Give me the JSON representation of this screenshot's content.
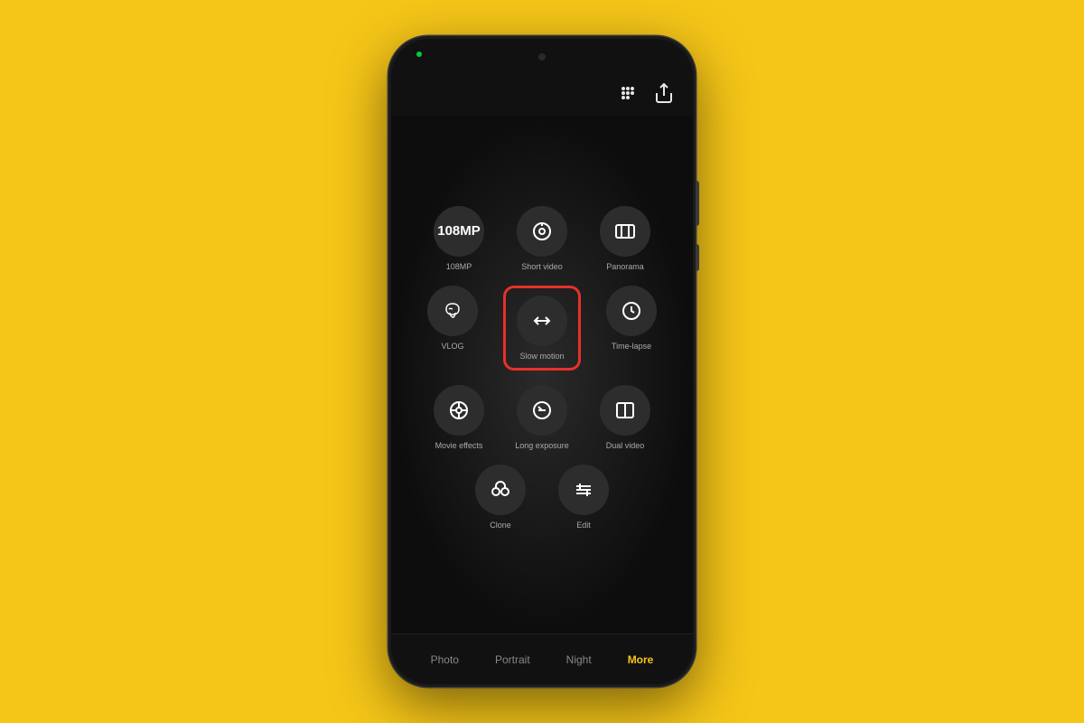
{
  "background_color": "#F5C518",
  "phone": {
    "status": {
      "green_dot": true,
      "camera_dot": true
    },
    "top_controls": {
      "apps_icon": "⠿",
      "share_icon": "⬡"
    },
    "grid": {
      "rows": [
        [
          {
            "id": "108mp",
            "label": "108MP",
            "type": "text108"
          },
          {
            "id": "short-video",
            "label": "Short video",
            "type": "play-circle"
          },
          {
            "id": "panorama",
            "label": "Panorama",
            "type": "panorama"
          }
        ],
        [
          {
            "id": "vlog",
            "label": "VLOG",
            "type": "vlog"
          },
          {
            "id": "slow-motion",
            "label": "Slow motion",
            "type": "slow-motion",
            "highlighted": true
          },
          {
            "id": "time-lapse",
            "label": "Time-lapse",
            "type": "time-lapse"
          }
        ],
        [
          {
            "id": "movie-effects",
            "label": "Movie effects",
            "type": "movie"
          },
          {
            "id": "long-exposure",
            "label": "Long exposure",
            "type": "long-exposure"
          },
          {
            "id": "dual-video",
            "label": "Dual video",
            "type": "dual-video"
          }
        ],
        [
          {
            "id": "clone",
            "label": "Clone",
            "type": "clone"
          },
          {
            "id": "edit",
            "label": "Edit",
            "type": "edit"
          }
        ]
      ]
    },
    "nav": {
      "items": [
        {
          "id": "photo",
          "label": "Photo",
          "active": false
        },
        {
          "id": "portrait",
          "label": "Portrait",
          "active": false
        },
        {
          "id": "night",
          "label": "Night",
          "active": false
        },
        {
          "id": "more",
          "label": "More",
          "active": true
        }
      ]
    }
  }
}
